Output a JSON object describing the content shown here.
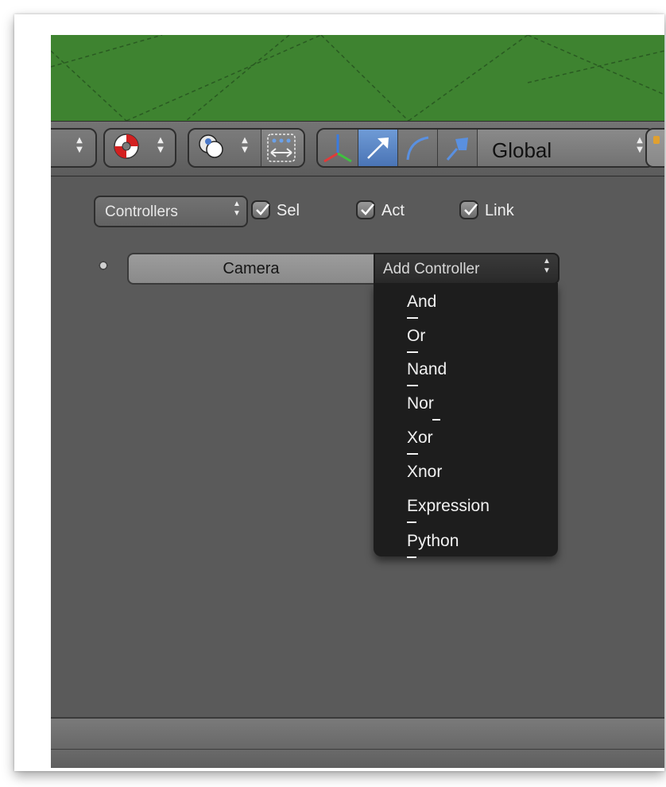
{
  "header": {
    "orientation_label": "Global"
  },
  "logic": {
    "controllers_select": "Controllers",
    "checks": [
      {
        "label": "Sel",
        "checked": true
      },
      {
        "label": "Act",
        "checked": true
      },
      {
        "label": "Link",
        "checked": true
      }
    ],
    "object_name": "Camera",
    "add_controller_label": "Add Controller"
  },
  "menu": {
    "items": [
      "And",
      "Or",
      "Nand",
      "Nor",
      "Xor",
      "Xnor",
      "Expression",
      "Python"
    ]
  },
  "colors": {
    "viewport_green": "#3e8330",
    "panel_gray": "#5a5a5a",
    "menu_bg": "#1d1d1d",
    "active_blue": "#5a86c6"
  },
  "icons": {
    "toolbar": [
      "updown-arrows-icon",
      "lifebuoy-icon",
      "pivot-icon",
      "snap-icon",
      "manipulator-axes-icon",
      "translate-arrow-icon",
      "rotate-arc-icon",
      "scale-icon"
    ]
  }
}
